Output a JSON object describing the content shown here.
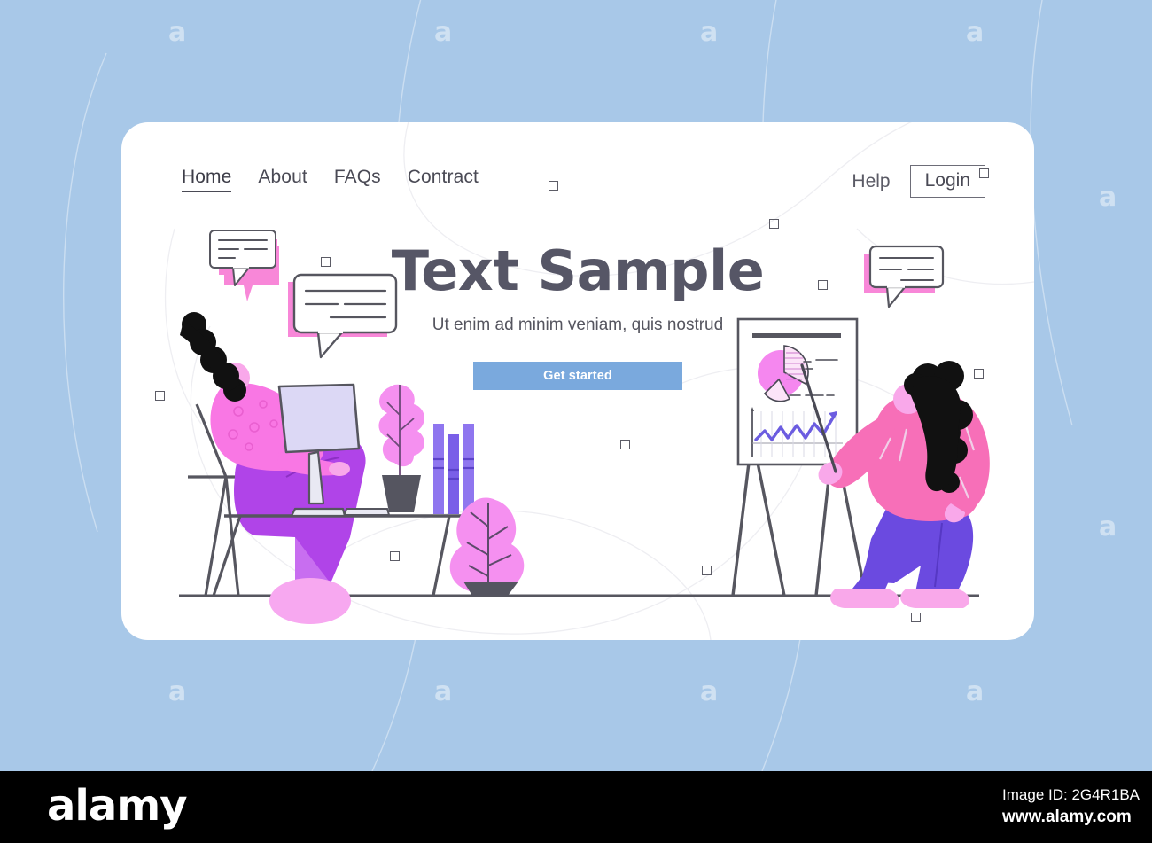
{
  "page": {
    "background_color": "#a8c8e8",
    "card_background": "#ffffff",
    "watermark_letter": "a"
  },
  "nav": {
    "links": [
      {
        "label": "Home",
        "active": true
      },
      {
        "label": "About",
        "active": false
      },
      {
        "label": "FAQs",
        "active": false
      },
      {
        "label": "Contract",
        "active": false
      }
    ],
    "help_label": "Help",
    "login_label": "Login"
  },
  "hero": {
    "title": "Text Sample",
    "subtitle": "Ut enim ad minim veniam, quis nostrud",
    "cta_label": "Get started",
    "cta_color": "#7aa9dd",
    "title_color": "#565666"
  },
  "illustration": {
    "seated_person": {
      "name": "person-at-desk",
      "hair_color": "#111111",
      "shirt_color": "#f77fe0",
      "pants_color": "#a93fe0",
      "skin_color": "#f9a8ea"
    },
    "standing_person": {
      "name": "person-presenting",
      "hair_color": "#111111",
      "shirt_color": "#f76fb8",
      "pants_color": "#6b4ae0",
      "skin_color": "#f9a8ea"
    },
    "desk_items": [
      "monitor",
      "keyboard",
      "potted-plant",
      "books"
    ],
    "flipchart": {
      "pie_color": "#f587ef",
      "line_color": "#6b5ce0"
    },
    "floor_plant": {
      "leaf_color": "#f590f0",
      "pot_color": "#555560"
    },
    "speech_bubbles": [
      {
        "id": "bubble-top-left",
        "fill": "#f887d8",
        "lines": 3
      },
      {
        "id": "bubble-mid-left",
        "fill": "#f887d8",
        "lines": 3
      },
      {
        "id": "bubble-top-right",
        "fill": "#f887d8",
        "lines": 3
      }
    ]
  },
  "footer": {
    "logo": "alamy",
    "image_id": "Image ID: 2G4R1BA",
    "url": "www.alamy.com"
  }
}
